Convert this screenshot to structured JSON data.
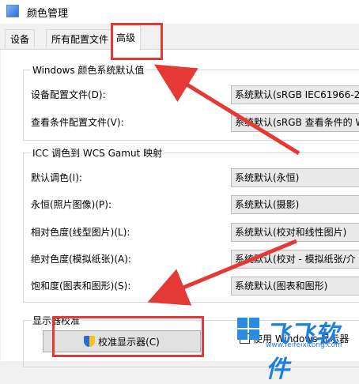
{
  "window": {
    "title": "颜色管理"
  },
  "tabs": [
    {
      "label": "设备"
    },
    {
      "label": "所有配置文件"
    },
    {
      "label": "高级"
    }
  ],
  "group_windows": {
    "label": "Windows 颜色系统默认值",
    "rows": [
      {
        "label": "设备配置文件(D):",
        "value": "系统默认(sRGB IEC61966-2."
      },
      {
        "label": "查看条件配置文件(V):",
        "value": "系统默认(sRGB 查看条件的 W"
      }
    ]
  },
  "group_icc": {
    "label": "ICC 调色到 WCS Gamut 映射",
    "rows": [
      {
        "label": "默认调色(I):",
        "value": "系统默认(永恒)"
      },
      {
        "label": "永恒(照片图像)(P):",
        "value": "系统默认(摄影)"
      },
      {
        "label": "相对色度(线型图片)(L):",
        "value": "系统默认(校对和线性图片)"
      },
      {
        "label": "绝对色度(模拟纸张)(A):",
        "value": "系统默认(校对 - 模拟纸张/介"
      },
      {
        "label": "饱和度(图表和图形)(S):",
        "value": "系统默认(图表和图形)"
      }
    ]
  },
  "group_calibration": {
    "label": "显示器校准",
    "calibrate_button": "校准显示器(C)",
    "checkbox_label": "使用 Windows 显示器"
  },
  "watermark": {
    "text": "飞飞软件",
    "url": "www.feifeixitong.com"
  },
  "colors": {
    "annotation": "#e53935",
    "watermark": "#1f7fe0"
  }
}
